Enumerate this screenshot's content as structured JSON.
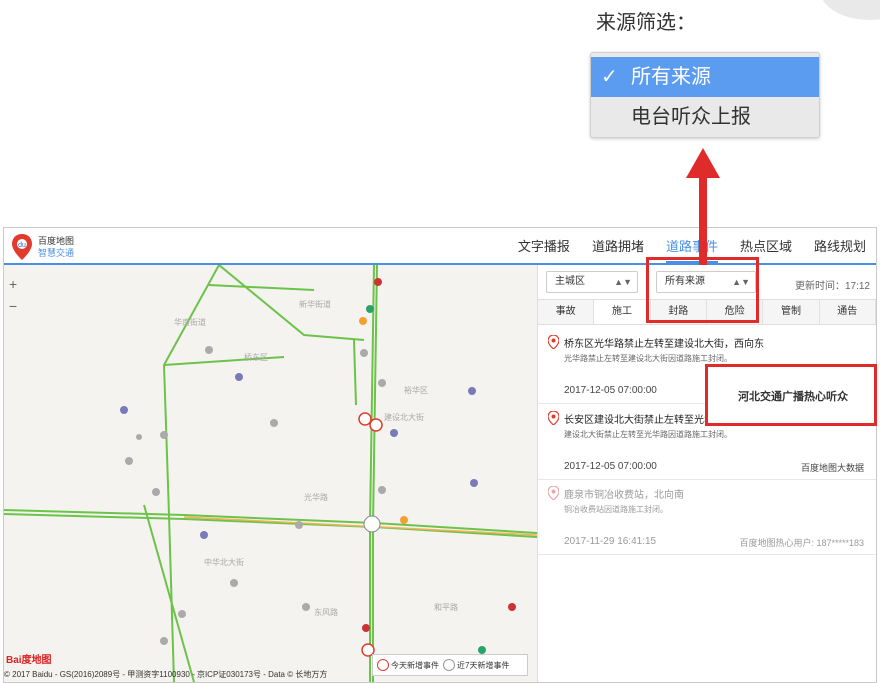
{
  "annotation": {
    "filter_caption": "来源筛选：",
    "options": [
      {
        "label": "所有来源",
        "selected": true
      },
      {
        "label": "电台听众上报",
        "selected": false
      }
    ],
    "check_mark": "✓",
    "callout_text": "河北交通广播热心听众",
    "accent_color": "#e02b2b"
  },
  "app": {
    "logo": {
      "line1": "百度地图",
      "line2": "智慧交通"
    },
    "nav": [
      "文字播报",
      "道路拥堵",
      "道路事件",
      "热点区域",
      "路线规划"
    ],
    "nav_active_index": 2,
    "accent_color": "#4a90e2"
  },
  "map": {
    "zoom_in": "+",
    "zoom_out": "−",
    "baidu_mark": "Bai度地图",
    "copyright": "© 2017 Baidu - GS(2016)2089号 - 甲测资字1100930 - 京ICP证030173号 - Data © 长地万方",
    "legend": [
      "今天新增事件",
      "近7天新增事件"
    ],
    "district_labels": [
      "华南街道",
      "新华街道",
      "桥东区",
      "裕华区",
      "光华路",
      "建设北大街",
      "中华北大街",
      "东风路",
      "和平路"
    ]
  },
  "panel": {
    "district_select": "主城区",
    "source_select": "所有来源",
    "update_time": "更新时间：17:12",
    "categories": [
      "事故",
      "施工",
      "封路",
      "危险",
      "管制",
      "通告"
    ],
    "active_category_index": 1,
    "events": [
      {
        "title": "桥东区光华路禁止左转至建设北大街，西向东",
        "desc": "光华路禁止左转至建设北大街因道路施工封闭。",
        "time": "2017-12-05 07:00:00",
        "source": ""
      },
      {
        "title": "长安区建设北大街禁止左转至光华路，南向北",
        "desc": "建设北大街禁止左转至光华路因道路施工封闭。",
        "time": "2017-12-05 07:00:00",
        "source": "百度地图大数据"
      },
      {
        "title": "鹿泉市铜冶收费站，北向南",
        "desc": "铜冶收费站因道路施工封闭。",
        "time": "2017-11-29 16:41:15",
        "source": "百度地图热心用户: 187*****183"
      }
    ]
  }
}
